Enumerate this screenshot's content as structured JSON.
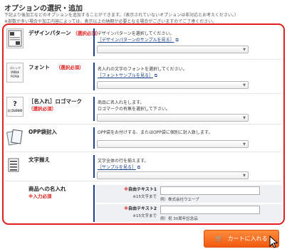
{
  "page": {
    "title": "オプションの選択・追加",
    "intro_line1": "下記より後加工などのオプションを追加することができます。（表示されていないオプションは非対応とお考えください。）",
    "intro_line2": "※部数が多い場合や加工内容によっては、表示以上の納期が必要となる場合がございますのでご了承ください。"
  },
  "options": [
    {
      "label": "デザインパターン",
      "required": "（選択必須）",
      "desc": "デザインパターンを選択してください。",
      "link": "［デザインパターンのサンプルを見る］",
      "icon": "design-pattern-icon"
    },
    {
      "label": "フォント",
      "required": "（選択必須）",
      "desc": "名入れの文字のフォントを選択してください。",
      "link": "［フォントサンプルを見る］",
      "icon": "font-icon",
      "icon_text": [
        "ゴシック",
        "明朝体",
        "POP体"
      ]
    },
    {
      "label": "［名入れ］ロゴマーク",
      "required": "（選択必須）",
      "desc": "商品に名入れをします。",
      "desc2": "ロゴマークの有無を選択して下さい。",
      "icon": "logo-mark-icon",
      "icon_text": "ロゴLOGO"
    },
    {
      "label": "OPP袋封入",
      "desc": "OPP袋をお付けする、またはOPP袋に個別に封入致します。",
      "icon": "opp-bag-icon"
    },
    {
      "label": "文字揃え",
      "desc": "文字全体の行を揃えます。",
      "link": "［サンプルを見る］",
      "icon": "align-text-icon"
    }
  ],
  "name_section": {
    "label": "商品への名入れ",
    "required": "※入力必須",
    "fields": [
      {
        "label_mark": "※",
        "label": "自由テキスト1",
        "sub": "※15文字まで",
        "example": "例）株式会社ウエーブ"
      },
      {
        "label_mark": "※",
        "label": "自由テキスト2",
        "sub": "※15文字まで",
        "example": "例）祝 30周年記念品"
      }
    ]
  },
  "cart": {
    "label": "カートに入れる"
  },
  "colors": {
    "accent_red": "#e02020",
    "navy": "#1a3f8f",
    "cart_orange": "#f15a11"
  }
}
